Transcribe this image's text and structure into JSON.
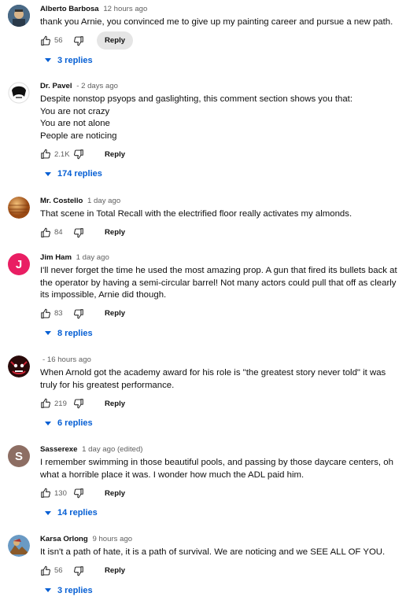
{
  "comments": [
    {
      "author": "Alberto Barbosa",
      "time": "12 hours ago",
      "lines": [
        "thank you Arnie, you convinced me to give up my painting career and pursue a new path."
      ],
      "likes": "56",
      "reply_label": "Reply",
      "replies": "3 replies",
      "avatar_color": "#3a5a7a"
    },
    {
      "author": "Dr. Pavel",
      "time": "- 2 days ago",
      "lines": [
        "Despite nonstop psyops and gaslighting, this comment section shows you that:",
        "You are not crazy",
        "You are not alone",
        "People are noticing"
      ],
      "likes": "2.1K",
      "reply_label": "Reply",
      "replies": "174 replies",
      "avatar_color": "#ffffff"
    },
    {
      "author": "Mr. Costello",
      "time": "1 day ago",
      "lines": [
        "That scene in Total Recall with the electrified floor really activates my almonds."
      ],
      "likes": "84",
      "reply_label": "Reply",
      "replies": "",
      "avatar_color": "#c8742a"
    },
    {
      "author": "Jim Ham",
      "time": "1 day ago",
      "lines": [
        "I'll never forget the time he used the most amazing prop. A gun that fired its bullets back at the operator by having a semi-circular barrel! Not many actors could pull that off as clearly its impossible, Arnie did though."
      ],
      "likes": "83",
      "reply_label": "Reply",
      "replies": "8 replies",
      "avatar_letter": "J",
      "avatar_color": "#e91e63"
    },
    {
      "author": "",
      "time": "- 16 hours ago",
      "lines": [
        "When Arnold got the academy award for his role is \"the greatest story never told\" it was truly for his greatest performance."
      ],
      "likes": "219",
      "reply_label": "Reply",
      "replies": "6 replies",
      "avatar_color": "#7a1a1a"
    },
    {
      "author": "Sasserexe",
      "time": "1 day ago (edited)",
      "lines": [
        "I remember swimming in those beautiful pools, and passing by those daycare centers, oh what a horrible place it was. I wonder how much the ADL paid him."
      ],
      "likes": "130",
      "reply_label": "Reply",
      "replies": "14 replies",
      "avatar_letter": "S",
      "avatar_color": "#8d6e63"
    },
    {
      "author": "Karsa Orlong",
      "time": "9 hours ago",
      "lines": [
        "It isn't a path of hate, it is a path of survival.  We are noticing and we SEE ALL OF YOU."
      ],
      "likes": "56",
      "reply_label": "Reply",
      "replies": "3 replies",
      "avatar_color": "#b07a3a"
    }
  ]
}
